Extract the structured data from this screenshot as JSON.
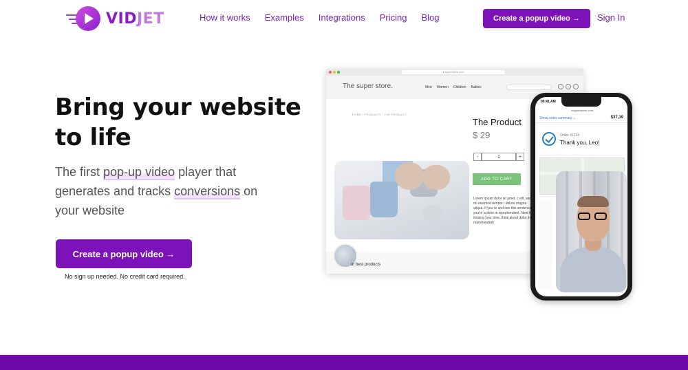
{
  "brand": {
    "name_part1": "VID",
    "name_part2": "JET",
    "colors": {
      "primary": "#7d12b8",
      "logo_light": "#c07ae0",
      "band": "#6e0ba8"
    }
  },
  "nav": {
    "items": [
      "How it works",
      "Examples",
      "Integrations",
      "Pricing",
      "Blog"
    ],
    "cta_label": "Create a popup video →",
    "signin_label": "Sign In"
  },
  "hero": {
    "headline_line1": "Bring your website",
    "headline_line2": "to life",
    "sub_part1": "The first ",
    "sub_highlight1": "pop-up video",
    "sub_part2": " player that generates and tracks ",
    "sub_highlight2": "conversions",
    "sub_part3": " on your website",
    "cta_label": "Create a popup video →",
    "cta_note": "No sign up needed. No credit card required."
  },
  "browser_mock": {
    "store_name": "The super store.",
    "store_nav": [
      "Men",
      "Women",
      "Children",
      "Babies"
    ],
    "breadcrumb": "HOME / PRODUCTS / THE PRODUCT",
    "product_title": "The Product",
    "product_price": "$ 29",
    "qty_minus": "-",
    "qty_value": "1",
    "qty_plus": "+",
    "add_to_cart": "ADD TO CART",
    "lorem": "Lorem ipsum dolor sit amet, c elit, sed do eiusmod tempor i dolore magna aliqua. If you re and see this sentence, you're a dolor in reprehendent. Next ti loosing your time, think about dolor in reprehenderit",
    "best_products": "ur best products"
  },
  "phone_mock": {
    "time": "09:41 AM",
    "url": "outgoodstore.com",
    "order_summary": "Show order summary ⌄",
    "total": "$37,19",
    "order_number": "Order #1234",
    "thanks": "Thank you, Leo!"
  }
}
